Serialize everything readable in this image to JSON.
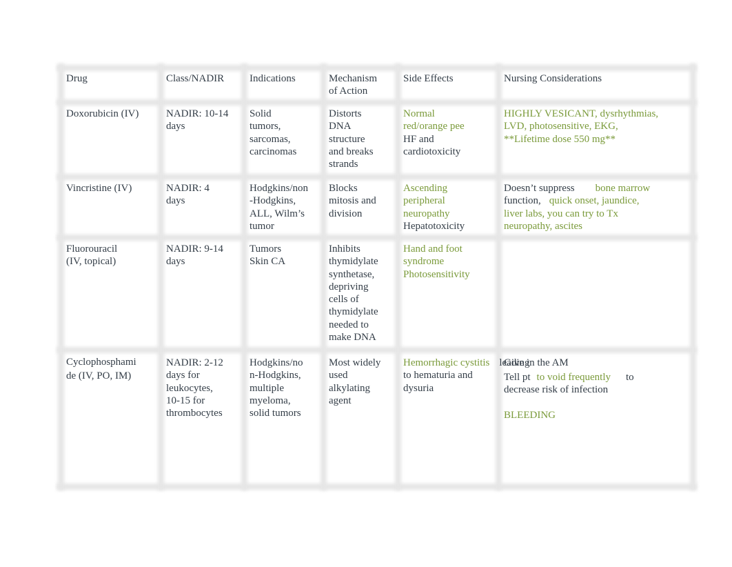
{
  "colors": {
    "text": "#333d47",
    "highlight": "#7a9a3a",
    "border": "#e6e6e6"
  },
  "headers": [
    "Drug",
    "Class/NADIR",
    "Indications",
    "Mechanism\nof Action",
    "Side Effects",
    "Nursing Considerations"
  ],
  "rows": [
    {
      "drug": "Doxorubicin (IV)",
      "nadir": "NADIR: 10-14\ndays",
      "indications": "Solid\ntumors,\nsarcomas,\ncarcinomas",
      "mechanism": "Distorts\nDNA\nstructure\nand breaks\nstrands",
      "side_effects_highlight": "Normal\nred/orange pee",
      "side_effects": "HF and\ncardiotoxicity",
      "nursing_highlight": "HIGHLY VESICANT, dysrhythmias,\nLVD, photosensitive, EKG,\n**Lifetime dose 550 mg**"
    },
    {
      "drug": "Vincristine (IV)",
      "nadir": "NADIR: 4\ndays",
      "indications": "Hodgkins/non\n-Hodgkins,\nALL, Wilm’s\ntumor",
      "mechanism": "Blocks\nmitosis and\ndivision",
      "side_effects_highlight": "Ascending\nperipheral\nneuropathy",
      "side_effects": "Hepatotoxicity",
      "nursing_1": "Doesn’t suppress",
      "nursing_1_highlight": "bone marrow",
      "nursing_2": "function,",
      "nursing_2_highlight": "quick onset, jaundice,\nliver labs, you can try to Tx\nneuropathy, ascites"
    },
    {
      "drug": "Fluorouracil\n(IV, topical)",
      "nadir": "NADIR: 9-14\ndays",
      "indications": "Tumors\nSkin CA",
      "mechanism": "Inhibits\nthymidylate\nsynthetase,\ndepriving\ncells of\nthymidylate\nneeded to\nmake DNA",
      "side_effects_highlight": "Hand and foot\nsyndrome\nPhotosensitivity"
    },
    {
      "drug": "Cyclophosphami\nde (IV, PO, IM)",
      "nadir": "NADIR: 2-12\ndays for\nleukocytes,\n10-15 for\nthrombocytes",
      "indications": "Hodgkins/no\nn-Hodgkins,\nmultiple\nmyeloma,\nsolid tumors",
      "mechanism": "Most widely\nused\nalkylating\nagent",
      "side_effects_highlight": "Hemorrhagic\ncystitis",
      "side_effects_1": "leading",
      "side_effects_2": "to hematuria and\ndysuria",
      "nursing_1": "Give in the AM",
      "nursing_2": "Tell pt",
      "nursing_2_highlight": "to void frequently",
      "nursing_2_end": "to",
      "nursing_3": "decrease risk of infection",
      "nursing_highlight": "BLEEDING"
    }
  ]
}
